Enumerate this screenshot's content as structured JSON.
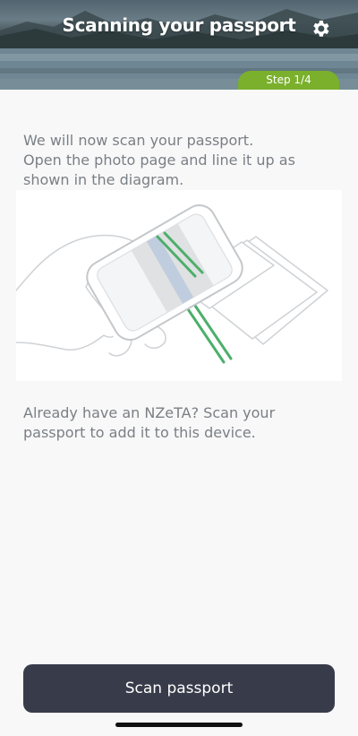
{
  "header": {
    "title": "Scanning your passport",
    "settings_icon": "gear-icon",
    "step_label": "Step 1/4"
  },
  "intro": {
    "line1": "We will now scan your passport.",
    "line2": "Open the photo page and line it up as",
    "line3": "shown in the diagram."
  },
  "note": {
    "line1": "Already have an NZeTA? Scan your",
    "line2": "passport to add it to this device."
  },
  "scan_button": {
    "label": "Scan passport"
  },
  "colors": {
    "accent_green": "#7ab02c",
    "button_dark": "#383c4a",
    "text_grey": "#7a7f85",
    "scan_line_green": "#4caf6a"
  }
}
